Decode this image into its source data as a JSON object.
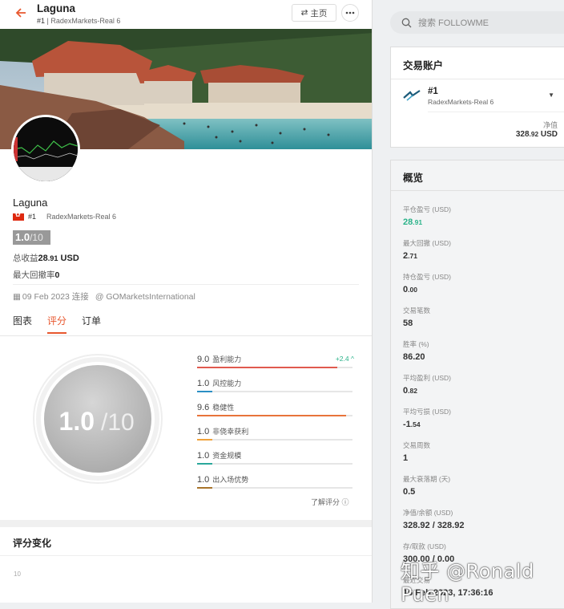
{
  "header": {
    "title": "Laguna",
    "sub_num": "#1",
    "sub_account": "RadexMarkets-Real 6",
    "home_label": "主页"
  },
  "profile": {
    "name": "Laguna",
    "sub_num": "#1",
    "sub_account": "RadexMarkets-Real 6",
    "score": "1.0",
    "score_den": "/10",
    "total_pnl_label": "总收益",
    "total_pnl_int": "28",
    "total_pnl_dec": ".91",
    "total_pnl_unit": "USD",
    "max_dd_label": "最大回撤率",
    "max_dd_value": "0",
    "date": "09 Feb 2023 连接",
    "broker": "@ GOMarketsInternational"
  },
  "tabs": [
    "图表",
    "评分",
    "订单"
  ],
  "active_tab": 1,
  "rating": {
    "big_score": "1.0",
    "big_den": "/10",
    "learn_label": "了解评分",
    "items": [
      {
        "num": "9.0",
        "name": "盈利能力",
        "value": 0.9,
        "color": "#e05a4f",
        "delta": "+2.4"
      },
      {
        "num": "1.0",
        "name": "风控能力",
        "value": 0.1,
        "color": "#2b8fc4",
        "delta": ""
      },
      {
        "num": "9.6",
        "name": "稳健性",
        "value": 0.96,
        "color": "#e8743b",
        "delta": ""
      },
      {
        "num": "1.0",
        "name": "非侥幸获利",
        "value": 0.1,
        "color": "#f0a23a",
        "delta": ""
      },
      {
        "num": "1.0",
        "name": "资金规模",
        "value": 0.1,
        "color": "#2aa79b",
        "delta": ""
      },
      {
        "num": "1.0",
        "name": "出入场优势",
        "value": 0.1,
        "color": "#a8742a",
        "delta": ""
      }
    ]
  },
  "rating_change": {
    "title": "评分变化",
    "axis_top": "10"
  },
  "search": {
    "placeholder": "搜索 FOLLOWME"
  },
  "account_card": {
    "title": "交易账户",
    "num": "#1",
    "account": "RadexMarkets-Real 6",
    "nv_label": "净值",
    "nv_int": "328",
    "nv_dec": ".92",
    "nv_unit": "USD"
  },
  "overview": {
    "title": "概览",
    "items": [
      {
        "label": "平仓盈亏 (USD)",
        "v1": "28",
        "v2": ".91",
        "green": true
      },
      {
        "label": "最大回撤 (USD)",
        "v1": "2",
        "v2": ".71"
      },
      {
        "label": "持仓盈亏 (USD)",
        "v1": "0",
        "v2": ".00"
      },
      {
        "label": "交易笔数",
        "v1": "58",
        "v2": ""
      },
      {
        "label": "胜率 (%)",
        "v1": "86.20",
        "v2": ""
      },
      {
        "label": "平均盈利 (USD)",
        "v1": "0",
        "v2": ".82"
      },
      {
        "label": "平均亏损 (USD)",
        "v1": "-1",
        "v2": ".54"
      },
      {
        "label": "交易周数",
        "v1": "1",
        "v2": ""
      },
      {
        "label": "最大衰落期 (天)",
        "v1": "0.5",
        "v2": ""
      },
      {
        "label": "净值/余额 (USD)",
        "v1": "328.92 / 328.92",
        "v2": ""
      },
      {
        "label": "存/取款 (USD)",
        "v1": "300.00 / 0.00",
        "v2": ""
      },
      {
        "label": "最近交易",
        "v1": "16 Feb 2023, 17:36:16",
        "v2": ""
      }
    ]
  },
  "watermark": "知乎 @Ronald Puen"
}
